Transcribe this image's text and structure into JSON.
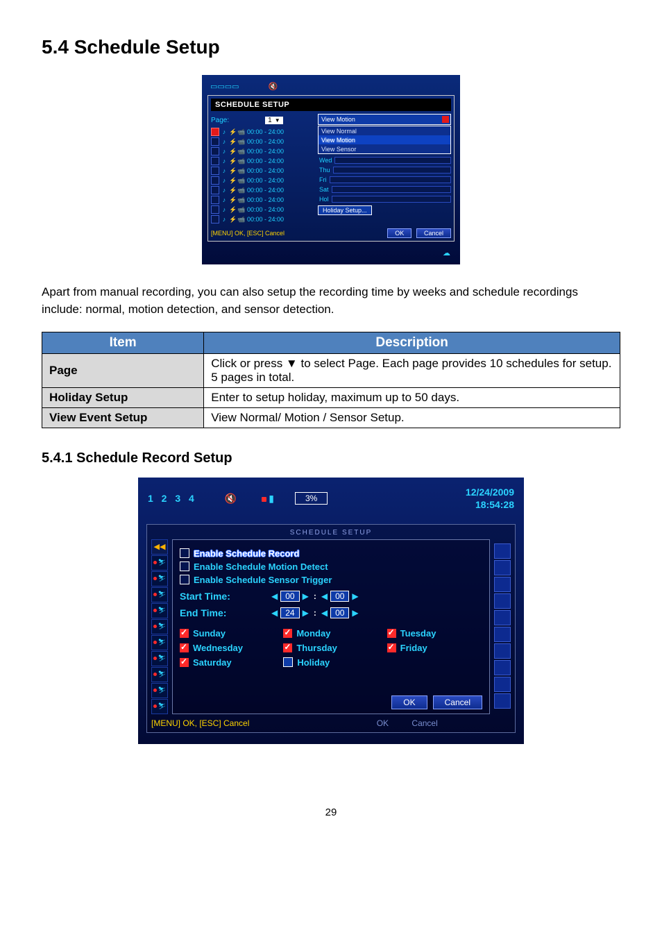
{
  "headings": {
    "h1": "5.4 Schedule Setup",
    "h2": "5.4.1 Schedule Record Setup"
  },
  "paragraph": "Apart from manual recording, you can also setup the recording time by weeks and schedule recordings include: normal, motion detection, and sensor detection.",
  "table": {
    "headers": [
      "Item",
      "Description"
    ],
    "rows": [
      {
        "item": "Page",
        "desc": "Click or press ▼ to select Page. Each page provides 10 schedules for setup. 5 pages in total."
      },
      {
        "item": "Holiday Setup",
        "desc": "Enter to setup holiday, maximum up to 50 days."
      },
      {
        "item": "View Event Setup",
        "desc": "View Normal/ Motion / Sensor Setup."
      }
    ]
  },
  "shot1": {
    "panel_title": "SCHEDULE SETUP",
    "page_label": "Page:",
    "page_value": "1",
    "time_range": "00:00 - 24:00",
    "view_selected": "View Motion",
    "dd_items": [
      "View Normal",
      "View Motion",
      "View Sensor"
    ],
    "days": [
      "Wed",
      "Thu",
      "Fri",
      "Sat",
      "Hol"
    ],
    "holiday_btn": "Holiday Setup...",
    "hint": "[MENU] OK, [ESC] Cancel",
    "ok": "OK",
    "cancel": "Cancel"
  },
  "shot2": {
    "channels": "1 2 3 4",
    "percent": "3%",
    "date": "12/24/2009",
    "time": "18:54:28",
    "title": "SCHEDULE SETUP",
    "enable_record": "Enable Schedule Record",
    "enable_motion": "Enable Schedule Motion Detect",
    "enable_sensor": "Enable Schedule Sensor Trigger",
    "start_time": "Start Time:",
    "end_time": "End Time:",
    "start_h": "00",
    "start_m": "00",
    "end_h": "24",
    "end_m": "00",
    "days": {
      "sun": "Sunday",
      "mon": "Monday",
      "tue": "Tuesday",
      "wed": "Wednesday",
      "thu": "Thursday",
      "fri": "Friday",
      "sat": "Saturday",
      "hol": "Holiday"
    },
    "ok": "OK",
    "cancel": "Cancel",
    "hint_main": "[MENU] OK, [ESC] Cancel",
    "hint_ghost_ok": "OK",
    "hint_ghost_cancel": "Cancel"
  },
  "page_number": "29"
}
